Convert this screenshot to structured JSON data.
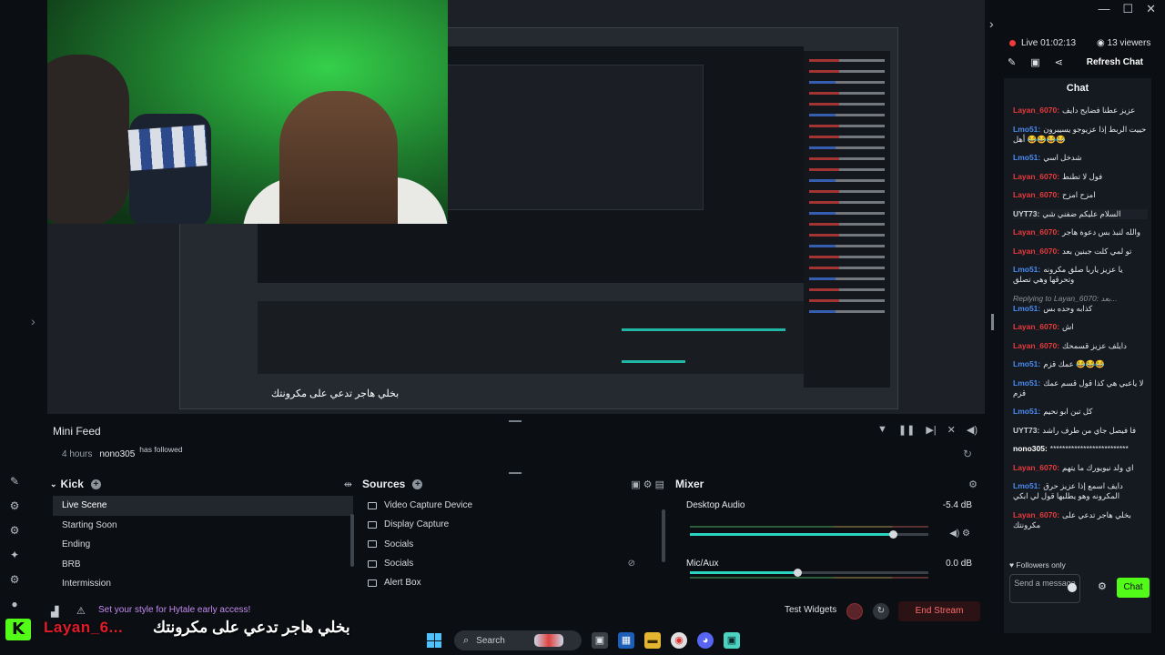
{
  "window": {
    "controls": [
      "—",
      "☐",
      "✕"
    ]
  },
  "preview": {
    "nested_caption": "بخلي هاجر تدعي على مكرونتك"
  },
  "mini_feed": {
    "title": "Mini Feed",
    "event": {
      "time": "4 hours",
      "user": "nono305",
      "message": "has followed"
    }
  },
  "scenes": {
    "title": "Kick",
    "items": [
      "Live Scene",
      "Starting Soon",
      "Ending",
      "BRB",
      "Intermission"
    ],
    "active_index": 0
  },
  "sources": {
    "title": "Sources",
    "items": [
      "Video Capture Device",
      "Display Capture",
      "Socials",
      "Socials",
      "Alert Box"
    ]
  },
  "mixer": {
    "title": "Mixer",
    "channels": [
      {
        "name": "Desktop Audio",
        "db": "-5.4 dB",
        "level": 0.85
      },
      {
        "name": "Mic/Aux",
        "db": "0.0 dB",
        "level": 0.45
      }
    ]
  },
  "status_bar": {
    "promo": "Set your style for Hytale early access!",
    "test_widgets": "Test Widgets",
    "end_stream": "End Stream"
  },
  "overlay": {
    "kick_logo": "K",
    "username": "Layan_6...",
    "message": "بخلي هاجر تدعي على مكرونتك"
  },
  "taskbar": {
    "search_placeholder": "Search"
  },
  "chat": {
    "live_label": "Live 01:02:13",
    "viewers": "13 viewers",
    "refresh": "Refresh Chat",
    "title": "Chat",
    "messages": [
      {
        "user": "Layan_6070:",
        "color": "red",
        "text": "عزيز عطنا فضايح دايف"
      },
      {
        "user": "Lmo51:",
        "color": "blue",
        "text": "حييت الربط إذا عزيوجو يسيبرون أهل 😂😂😂😂"
      },
      {
        "user": "Lmo51:",
        "color": "blue",
        "text": "شدخل اسي"
      },
      {
        "user": "Layan_6070:",
        "color": "red",
        "text": "فول لا تطنط"
      },
      {
        "user": "Layan_6070:",
        "color": "red",
        "text": "امزح امزح"
      },
      {
        "user": "UYT73:",
        "color": "grey",
        "text": "السلام عليكم ضفني شي",
        "highlight": true
      },
      {
        "user": "Layan_6070:",
        "color": "red",
        "text": "والله لنبذ بس دعوة هاجر"
      },
      {
        "user": "Layan_6070:",
        "color": "red",
        "text": "تو لمي كلت جبنين بعد"
      },
      {
        "user": "Lmo51:",
        "color": "blue",
        "text": "يا عزيز ياربا صلق مكرونه وتحرقها وهي تصلق"
      },
      {
        "reply": "Replying to Layan_6070: بعد...",
        "user": "Lmo51:",
        "color": "blue",
        "text": "كذابه وحده بس"
      },
      {
        "user": "Layan_6070:",
        "color": "red",
        "text": "اش"
      },
      {
        "user": "Layan_6070:",
        "color": "red",
        "text": "دايلف عزيز قسمحك"
      },
      {
        "user": "Lmo51:",
        "color": "blue",
        "text": "عمك قزم 😂😂😂"
      },
      {
        "user": "Lmo51:",
        "color": "blue",
        "text": "لا ياعبي هي كذا قول قسم عمك قزم"
      },
      {
        "user": "Lmo51:",
        "color": "blue",
        "text": "كل تبن ابو نحيم"
      },
      {
        "user": "UYT73:",
        "color": "grey",
        "text": "فا فيصل جاي من طرف راشد"
      },
      {
        "user": "nono305:",
        "color": "white",
        "text": "**************************"
      },
      {
        "user": "Layan_6070:",
        "color": "red",
        "text": "اي ولد نيويورك ما يتهم"
      },
      {
        "user": "Lmo51:",
        "color": "blue",
        "text": "دايف اسمع إذا عزيز حرق المكرونه وهو يطلبها قول لي ابكي"
      },
      {
        "user": "Layan_6070:",
        "color": "red",
        "text": "بخلي هاجر تدعي على مكرونتك"
      }
    ],
    "followers_only": "Followers only",
    "send_placeholder": "Send a message",
    "send_button": "Chat"
  }
}
